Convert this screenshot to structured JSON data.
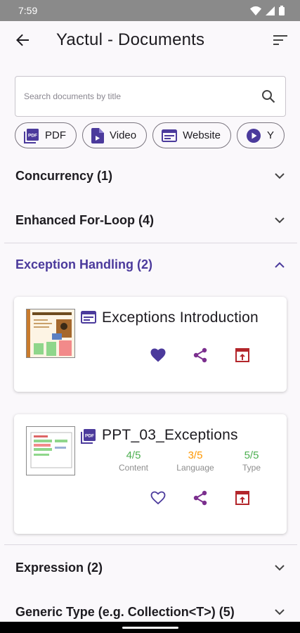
{
  "status": {
    "time": "7:59"
  },
  "header": {
    "title": "Yactul - Documents"
  },
  "search": {
    "placeholder": "Search documents by title"
  },
  "chips": [
    {
      "label": "PDF",
      "icon": "pdf-icon"
    },
    {
      "label": "Video",
      "icon": "video-file-icon"
    },
    {
      "label": "Website",
      "icon": "website-icon"
    },
    {
      "label": "Y",
      "icon": "play-circle-icon"
    }
  ],
  "sections": [
    {
      "label": "Concurrency (1)",
      "expanded": false
    },
    {
      "label": "Enhanced For-Loop (4)",
      "expanded": false
    },
    {
      "label": "Exception Handling (2)",
      "expanded": true
    },
    {
      "label": "Expression (2)",
      "expanded": false
    },
    {
      "label": "Generic Type (e.g. Collection<T>) (5)",
      "expanded": false
    }
  ],
  "documents": [
    {
      "title": "Exceptions Introduction",
      "type_icon": "website-icon",
      "favorited": true,
      "thumb_text": "Exceptions: Introduction"
    },
    {
      "title": "PPT_03_Exceptions",
      "type_icon": "pdf-icon",
      "favorited": false,
      "ratings": [
        {
          "value": "4/5",
          "label": "Content",
          "color": "#4caf50"
        },
        {
          "value": "3/5",
          "label": "Language",
          "color": "#ff9800"
        },
        {
          "value": "5/5",
          "label": "Type",
          "color": "#4caf50"
        }
      ]
    }
  ],
  "colors": {
    "accent": "#4b3a9c",
    "share": "#7b2f8e",
    "open": "#b3262b"
  }
}
